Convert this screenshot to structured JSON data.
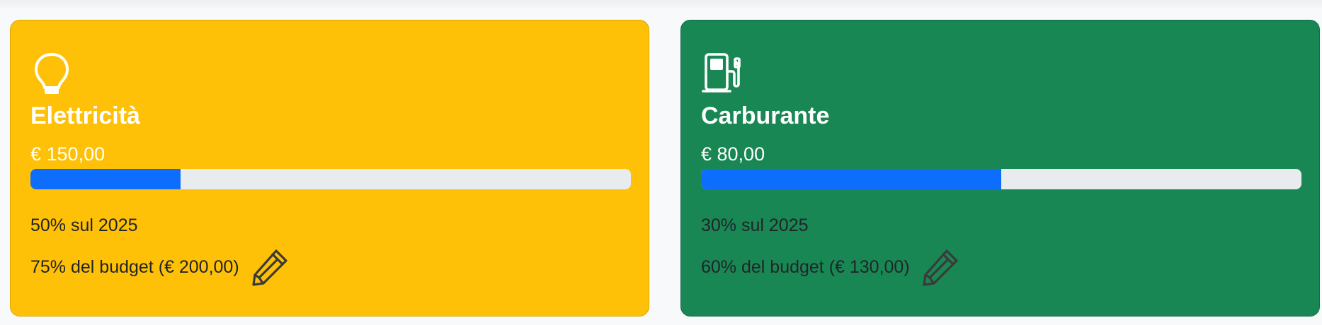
{
  "colors": {
    "card_electricity_bg": "#ffc107",
    "card_fuel_bg": "#198754",
    "progress_fill": "#0d6efd",
    "progress_track": "#e9ecef",
    "text_light": "#ffffff",
    "text_dark": "#212529"
  },
  "cards": [
    {
      "icon": "lightbulb-icon",
      "title": "Elettricità",
      "amount": "€ 150,00",
      "progress_fraction": 0.25,
      "yoy_text": "50% sul 2025",
      "budget_text": "75% del budget (€ 200,00)",
      "edit_icon": "pencil-icon"
    },
    {
      "icon": "fuel-pump-icon",
      "title": "Carburante",
      "amount": "€ 80,00",
      "progress_fraction": 0.5,
      "yoy_text": "30% sul 2025",
      "budget_text": "60% del budget (€ 130,00)",
      "edit_icon": "pencil-icon"
    }
  ]
}
